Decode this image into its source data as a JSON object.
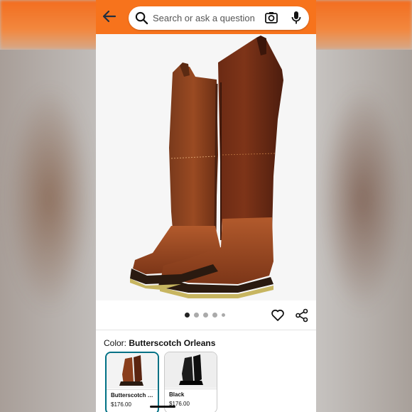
{
  "search": {
    "placeholder": "Search or ask a question"
  },
  "icons": {
    "back": "arrow-left-icon",
    "search": "search-icon",
    "camera": "camera-search-icon",
    "mic": "microphone-icon",
    "heart": "heart-icon",
    "share": "share-icon"
  },
  "carousel": {
    "total_dots": 5,
    "active_index": 0
  },
  "product": {
    "color_label": "Color:",
    "selected_color": "Butterscotch Orleans"
  },
  "swatches": [
    {
      "name": "Butterscotch O...",
      "price": "$176.00",
      "selected": true
    },
    {
      "name": "Black",
      "price": "$176.00",
      "selected": false
    }
  ],
  "colors": {
    "header": "#f7731c",
    "selected_border": "#007185"
  }
}
